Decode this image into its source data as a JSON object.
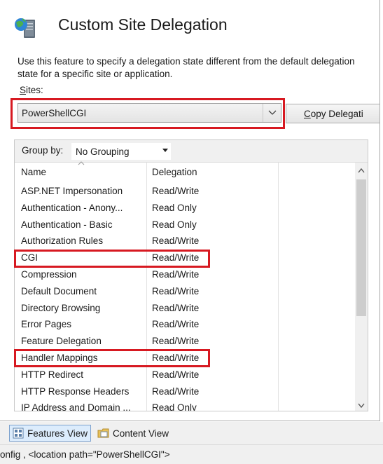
{
  "title": "Custom Site Delegation",
  "description": "Use this feature to specify a delegation state different from the default delegation state for a specific site or application.",
  "sites": {
    "label_prefix": "S",
    "label_rest": "ites:",
    "selected": "PowerShellCGI"
  },
  "copy_button": {
    "label_prefix": "C",
    "label_rest": "opy Delegati"
  },
  "group_by": {
    "label": "Group by:",
    "selected": "No Grouping"
  },
  "columns": {
    "name": "Name",
    "delegation": "Delegation"
  },
  "rows": [
    {
      "name": "ASP.NET Impersonation",
      "delegation": "Read/Write"
    },
    {
      "name": "Authentication - Anony...",
      "delegation": "Read Only"
    },
    {
      "name": "Authentication - Basic",
      "delegation": "Read Only"
    },
    {
      "name": "Authorization Rules",
      "delegation": "Read/Write"
    },
    {
      "name": "CGI",
      "delegation": "Read/Write"
    },
    {
      "name": "Compression",
      "delegation": "Read/Write"
    },
    {
      "name": "Default Document",
      "delegation": "Read/Write"
    },
    {
      "name": "Directory Browsing",
      "delegation": "Read/Write"
    },
    {
      "name": "Error Pages",
      "delegation": "Read/Write"
    },
    {
      "name": "Feature Delegation",
      "delegation": "Read/Write"
    },
    {
      "name": "Handler Mappings",
      "delegation": "Read/Write"
    },
    {
      "name": "HTTP Redirect",
      "delegation": "Read/Write"
    },
    {
      "name": "HTTP Response Headers",
      "delegation": "Read/Write"
    },
    {
      "name": "IP Address and Domain ...",
      "delegation": "Read Only"
    }
  ],
  "views": {
    "features": "Features View",
    "content": "Content View"
  },
  "status_text": "onfig , <location path=\"PowerShellCGI\">",
  "colors": {
    "highlight_red": "#d71921",
    "selected_view_bg": "#dcecfc"
  },
  "icons": {
    "title": "server-globe-icon",
    "features_view": "features-view-icon",
    "content_view": "content-view-icon"
  }
}
